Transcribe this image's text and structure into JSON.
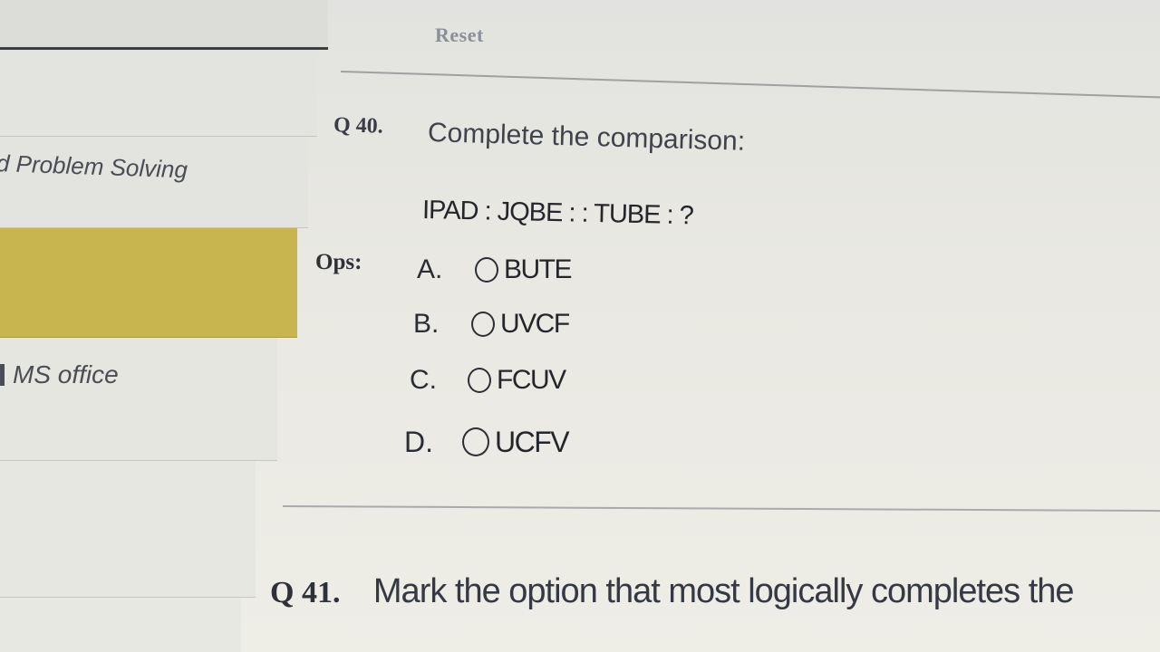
{
  "toolbar": {
    "reset_label": "Reset"
  },
  "sidebar": {
    "items": [
      {
        "label": "d Problem Solving"
      },
      {
        "label": ""
      },
      {
        "label": "MS office"
      }
    ]
  },
  "questions": [
    {
      "number": "Q 40.",
      "text": "Complete the comparison:",
      "problem": "IPAD : JQBE : : TUBE : ?",
      "options_label": "Ops:",
      "options": [
        {
          "letter": "A.",
          "text": "BUTE",
          "selected": false
        },
        {
          "letter": "B.",
          "text": "UVCF",
          "selected": false
        },
        {
          "letter": "C.",
          "text": "FCUV",
          "selected": false
        },
        {
          "letter": "D.",
          "text": "UCFV",
          "selected": false
        }
      ]
    },
    {
      "number": "Q 41.",
      "text": "Mark the option that most logically completes the"
    }
  ],
  "colors": {
    "highlight_item": "#c9b54f",
    "panel_background": "#e9e8e2",
    "text_primary": "#24262b"
  }
}
